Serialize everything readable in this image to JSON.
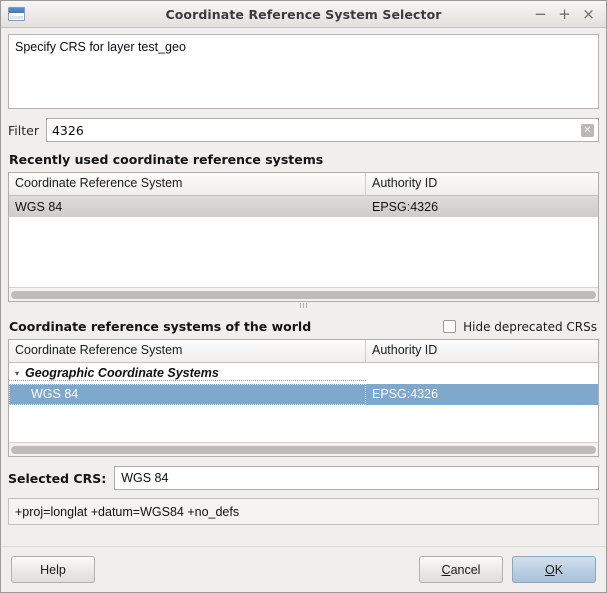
{
  "window": {
    "title": "Coordinate Reference System Selector",
    "icon": "window-icon",
    "controls": [
      {
        "name": "minimize",
        "glyph": "−"
      },
      {
        "name": "maximize",
        "glyph": "+"
      },
      {
        "name": "close",
        "glyph": "×"
      }
    ]
  },
  "description": {
    "text": "Specify CRS for layer test_geo"
  },
  "filter": {
    "label": "Filter",
    "value": "4326",
    "placeholder": "",
    "clear_icon": "clear-text-icon",
    "clear_glyph": "✕"
  },
  "recent": {
    "heading": "Recently used coordinate reference systems",
    "columns": [
      "Coordinate Reference System",
      "Authority ID"
    ],
    "rows": [
      {
        "crs": "WGS 84",
        "authority": "EPSG:4326",
        "state": "hovered"
      }
    ]
  },
  "world": {
    "heading": "Coordinate reference systems of the world",
    "hide_deprecated": {
      "label": "Hide deprecated CRSs",
      "checked": false
    },
    "columns": [
      "Coordinate Reference System",
      "Authority ID"
    ],
    "rows": [
      {
        "type": "group",
        "crs": "Geographic Coordinate Systems",
        "authority": "",
        "expanded": true,
        "triangle": "▾"
      },
      {
        "type": "item",
        "crs": "WGS 84",
        "authority": "EPSG:4326",
        "state": "selected"
      }
    ]
  },
  "selected": {
    "label": "Selected CRS:",
    "value": "WGS 84",
    "proj_string": "+proj=longlat +datum=WGS84 +no_defs"
  },
  "buttons": {
    "help": {
      "label": "Help",
      "mnemonic": ""
    },
    "cancel": {
      "pre": "",
      "mnemonic": "C",
      "post": "ancel"
    },
    "ok": {
      "pre": "",
      "mnemonic": "O",
      "post": "K"
    }
  },
  "colors": {
    "selection_blue": "#7fa8cd",
    "default_button_blue": "#bcd0e3",
    "window_bg": "#f0efee",
    "field_bg": "#ffffff"
  }
}
